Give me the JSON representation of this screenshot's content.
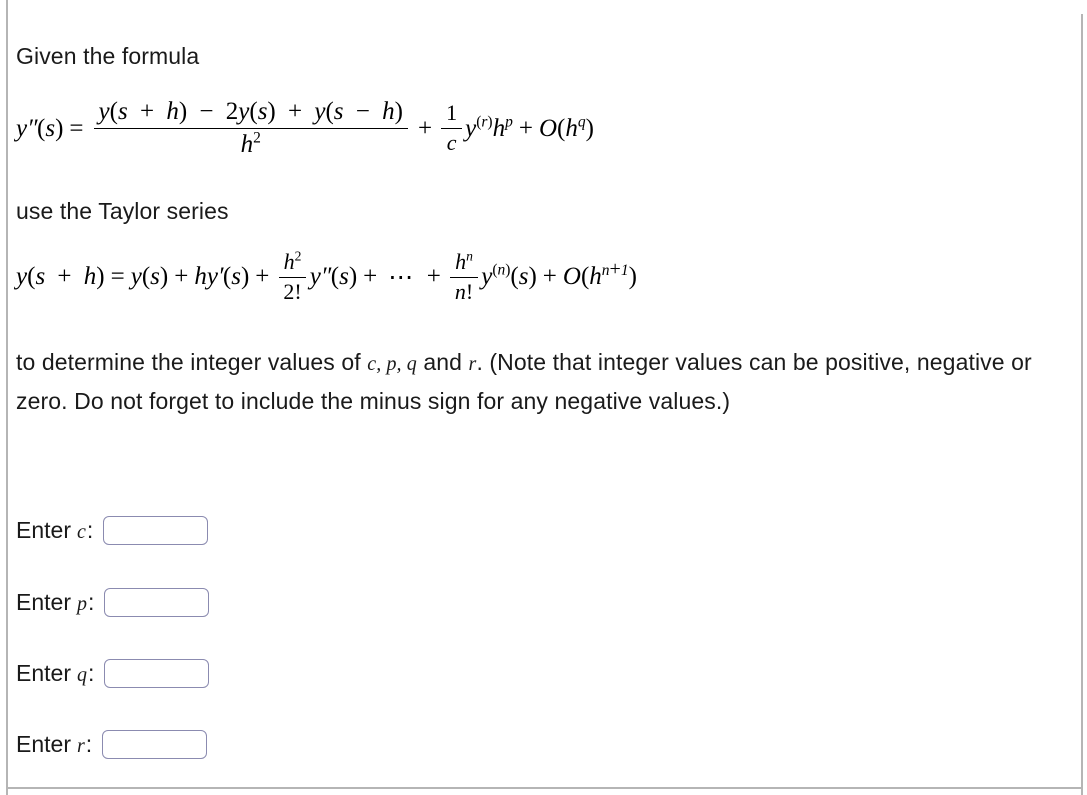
{
  "page": {
    "background_color": "#ffffff",
    "frame_rule_color": "#b5b5b5",
    "text_color": "#1a1a1a"
  },
  "prose": {
    "given_formula": "Given the formula",
    "use_taylor": "use the Taylor series",
    "determine_part1": "to determine the integer values of",
    "determine_vars": "c, p, q",
    "determine_and": "and",
    "determine_r": "r",
    "determine_part2": ". (Note that integer values can be positive, negative or zero. Do not forget to include the minus sign for any negative values.)"
  },
  "equations": {
    "central_difference": {
      "lhs": "y''(s)",
      "equals": "=",
      "fraction_numerator": "y(s + h) − 2y(s) + y(s − h)",
      "fraction_denominator": "h²",
      "plus": "+",
      "coefficient_numerator": "1",
      "coefficient_denominator": "c",
      "derivative_term": "y(r)hp",
      "error_term": "O(hq)",
      "plain": "y''(s) = [y(s + h) − 2y(s) + y(s − h)] / h² + (1/c) y^(r) h^p + O(h^q)"
    },
    "taylor_series": {
      "lhs": "y(s + h)",
      "equals": "=",
      "term1": "y(s)",
      "term2": "hy'(s)",
      "term3_numerator": "h²",
      "term3_denominator": "2!",
      "term3_factor": "y''(s)",
      "ellipsis": "⋯",
      "termn_numerator": "hⁿ",
      "termn_denominator": "n!",
      "termn_factor": "y(n)(s)",
      "error_term": "O(hn+1)",
      "plain": "y(s + h) = y(s) + hy'(s) + (h²/2!) y''(s) + ⋯ + (hⁿ/n!) y^(n)(s) + O(h^(n+1))"
    },
    "symbols": {
      "y": "y",
      "s": "s",
      "h": "h",
      "c": "c",
      "p": "p",
      "q": "q",
      "r": "r",
      "n": "n",
      "O": "O",
      "plus": "+",
      "minus": "−",
      "equals": "=",
      "two": "2",
      "one": "1",
      "factorial": "!",
      "lparen": "(",
      "rparen": ")",
      "prime2": "''",
      "prime1": "'",
      "exp_two": "2",
      "exp_n": "n",
      "exp_n_plus_1": "n+1"
    }
  },
  "answers": {
    "border_color": "#8b8bb0",
    "fields": [
      {
        "label_word": "Enter",
        "variable": "c",
        "colon": ":",
        "value": "",
        "placeholder": ""
      },
      {
        "label_word": "Enter",
        "variable": "p",
        "colon": ":",
        "value": "",
        "placeholder": ""
      },
      {
        "label_word": "Enter",
        "variable": "q",
        "colon": ":",
        "value": "",
        "placeholder": ""
      },
      {
        "label_word": "Enter",
        "variable": "r",
        "colon": ":",
        "value": "",
        "placeholder": ""
      }
    ]
  }
}
